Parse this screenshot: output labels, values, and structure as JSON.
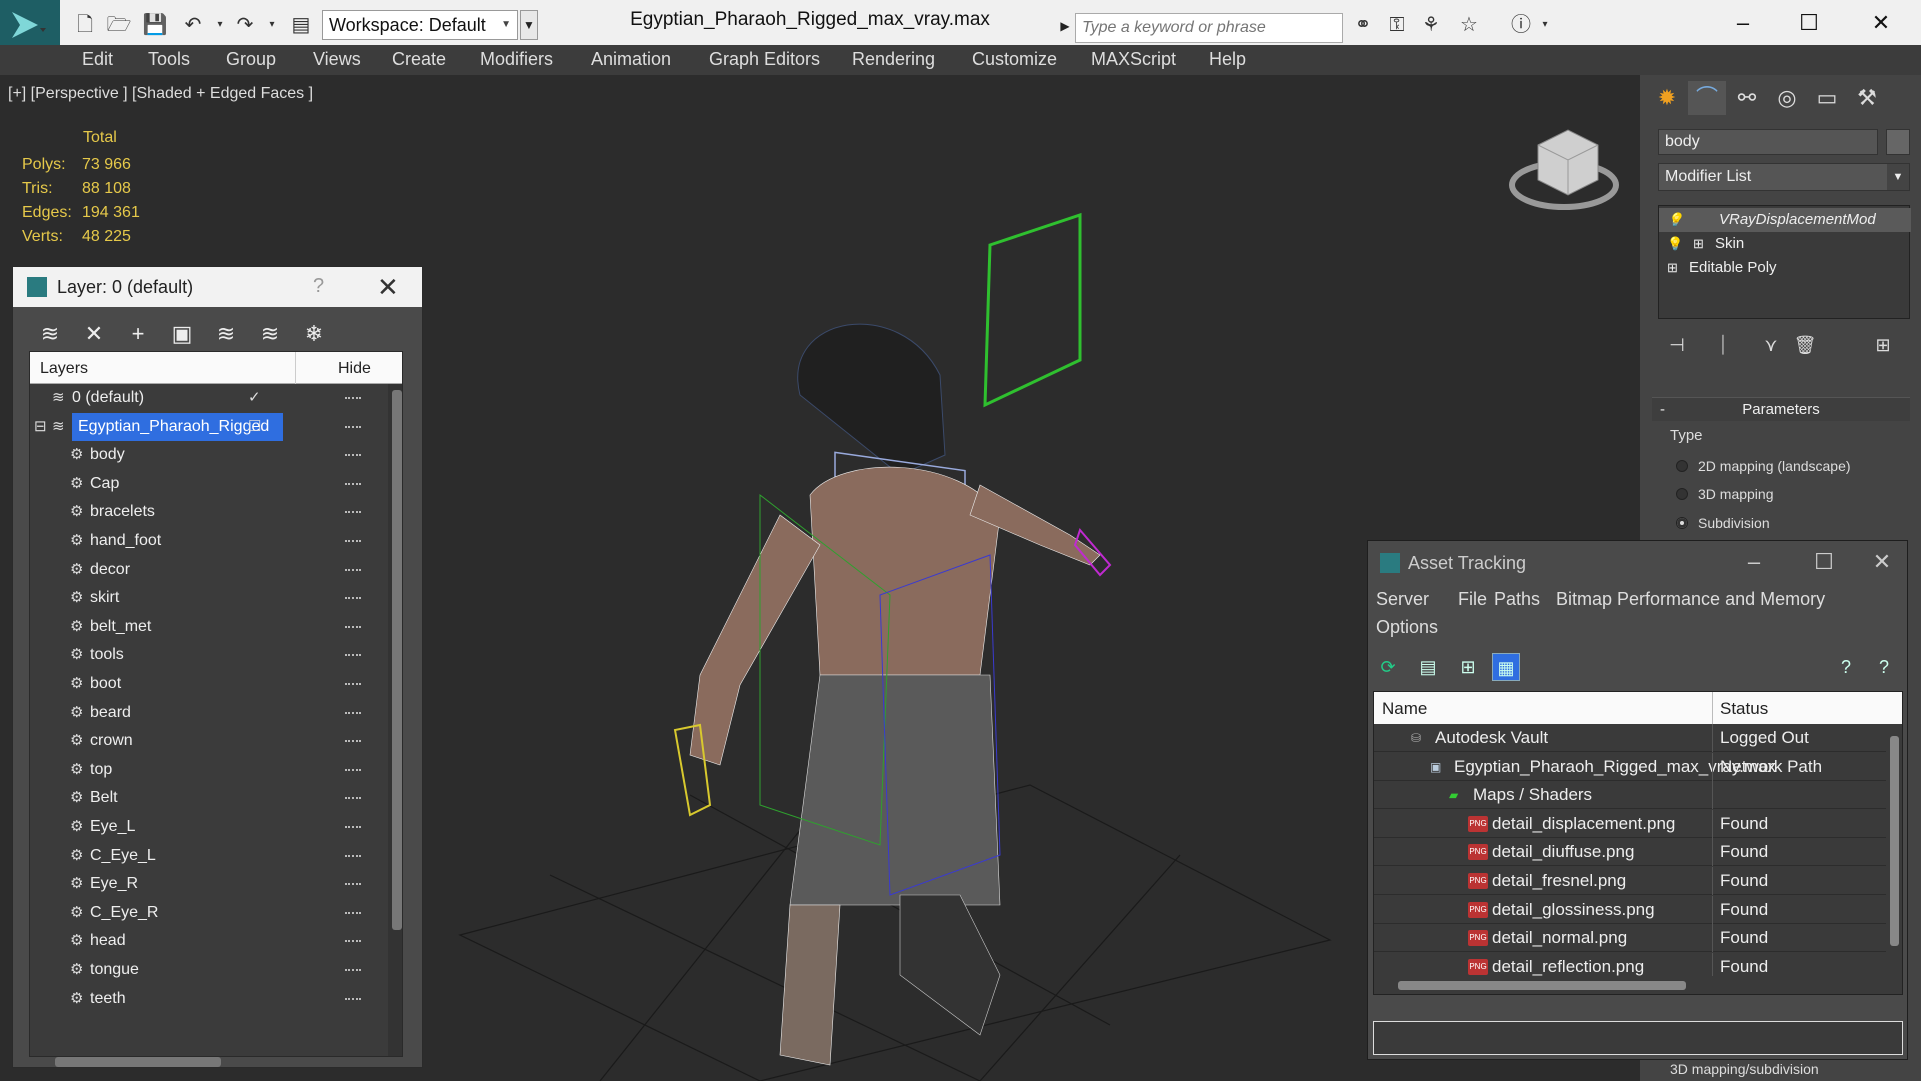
{
  "titlebar": {
    "workspace_label": "Workspace: Default",
    "file_title": "Egyptian_Pharaoh_Rigged_max_vray.max",
    "search_placeholder": "Type a keyword or phrase"
  },
  "menubar": {
    "items": [
      "Edit",
      "Tools",
      "Group",
      "Views",
      "Create",
      "Modifiers",
      "Animation",
      "Graph Editors",
      "Rendering",
      "Customize",
      "MAXScript",
      "Help"
    ]
  },
  "viewport": {
    "label": "[+] [Perspective ] [Shaded + Edged Faces ]",
    "stats_title": "Total",
    "stats": [
      {
        "label": "Polys:",
        "value": "73 966"
      },
      {
        "label": "Tris:",
        "value": "88 108"
      },
      {
        "label": "Edges:",
        "value": "194 361"
      },
      {
        "label": "Verts:",
        "value": "48 225"
      }
    ]
  },
  "layer_panel": {
    "title": "Layer: 0 (default)",
    "help": "?",
    "col_layers": "Layers",
    "col_hide": "Hide",
    "rows": [
      {
        "name": "0 (default)",
        "level": 0,
        "active": true
      },
      {
        "name": "Egyptian_Pharaoh_Rigged",
        "level": 0,
        "selected": true
      },
      {
        "name": "body",
        "level": 1
      },
      {
        "name": "Cap",
        "level": 1
      },
      {
        "name": "bracelets",
        "level": 1
      },
      {
        "name": "hand_foot",
        "level": 1
      },
      {
        "name": "decor",
        "level": 1
      },
      {
        "name": "skirt",
        "level": 1
      },
      {
        "name": "belt_met",
        "level": 1
      },
      {
        "name": "tools",
        "level": 1
      },
      {
        "name": "boot",
        "level": 1
      },
      {
        "name": "beard",
        "level": 1
      },
      {
        "name": "crown",
        "level": 1
      },
      {
        "name": "top",
        "level": 1
      },
      {
        "name": "Belt",
        "level": 1
      },
      {
        "name": "Eye_L",
        "level": 1
      },
      {
        "name": "C_Eye_L",
        "level": 1
      },
      {
        "name": "Eye_R",
        "level": 1
      },
      {
        "name": "C_Eye_R",
        "level": 1
      },
      {
        "name": "head",
        "level": 1
      },
      {
        "name": "tongue",
        "level": 1
      },
      {
        "name": "teeth",
        "level": 1
      }
    ]
  },
  "command_panel": {
    "object_name": "body",
    "modifier_list": "Modifier List",
    "stack": [
      {
        "label": "VRayDisplacementMod",
        "selected": true
      },
      {
        "label": "Skin",
        "selected": false
      },
      {
        "label": "Editable Poly",
        "selected": false
      }
    ],
    "params_title": "Parameters",
    "type_label": "Type",
    "options": [
      {
        "label": "2D mapping (landscape)",
        "on": false
      },
      {
        "label": "3D mapping",
        "on": false
      },
      {
        "label": "Subdivision",
        "on": true
      }
    ],
    "bottom_note": "3D mapping/subdivision"
  },
  "asset_panel": {
    "title": "Asset Tracking",
    "menu": [
      "Server",
      "File",
      "Paths",
      "Bitmap Performance and Memory",
      "Options"
    ],
    "col_name": "Name",
    "col_status": "Status",
    "rows": [
      {
        "name": "Autodesk Vault",
        "status": "Logged Out",
        "indent": 1,
        "icon": "vault"
      },
      {
        "name": "Egyptian_Pharaoh_Rigged_max_vray.max",
        "status": "Network Path",
        "indent": 2,
        "icon": "max"
      },
      {
        "name": "Maps / Shaders",
        "status": "",
        "indent": 3,
        "icon": "maps"
      },
      {
        "name": "detail_displacement.png",
        "status": "Found",
        "indent": 4,
        "icon": "png"
      },
      {
        "name": "detail_diuffuse.png",
        "status": "Found",
        "indent": 4,
        "icon": "png"
      },
      {
        "name": "detail_fresnel.png",
        "status": "Found",
        "indent": 4,
        "icon": "png"
      },
      {
        "name": "detail_glossiness.png",
        "status": "Found",
        "indent": 4,
        "icon": "png"
      },
      {
        "name": "detail_normal.png",
        "status": "Found",
        "indent": 4,
        "icon": "png"
      },
      {
        "name": "detail_reflection.png",
        "status": "Found",
        "indent": 4,
        "icon": "png"
      }
    ]
  }
}
